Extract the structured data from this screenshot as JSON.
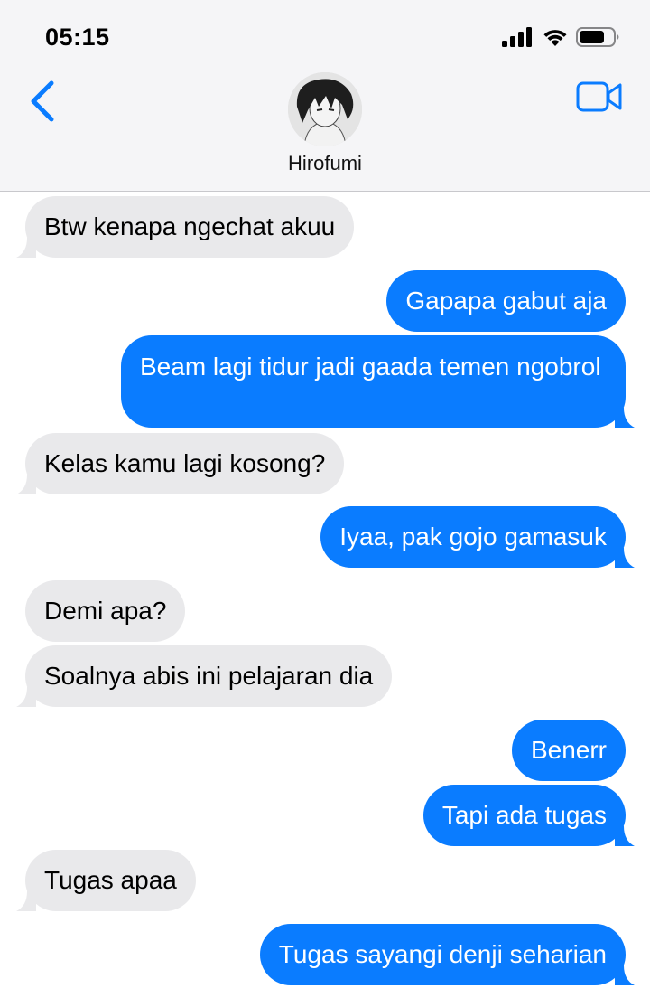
{
  "status_bar": {
    "time": "05:15"
  },
  "header": {
    "contact_name": "Hirofumi"
  },
  "icons": {
    "back": "chevron-left-icon",
    "video": "video-camera-icon",
    "signal": "signal-bars-icon",
    "wifi": "wifi-icon",
    "battery": "battery-icon"
  },
  "colors": {
    "accent": "#0a7cff",
    "incoming_bubble": "#e9e9eb",
    "header_bg": "#f5f5f7"
  },
  "messages": [
    {
      "from": "them",
      "text": "Btw kenapa ngechat akuu"
    },
    {
      "from": "me",
      "text": "Gapapa gabut aja"
    },
    {
      "from": "me",
      "text": "Beam lagi tidur jadi gaada temen ngobrol"
    },
    {
      "from": "them",
      "text": "Kelas kamu lagi kosong?"
    },
    {
      "from": "me",
      "text": "Iyaa, pak gojo gamasuk"
    },
    {
      "from": "them",
      "text": "Demi apa?"
    },
    {
      "from": "them",
      "text": "Soalnya abis ini pelajaran dia"
    },
    {
      "from": "me",
      "text": "Benerr"
    },
    {
      "from": "me",
      "text": "Tapi ada tugas"
    },
    {
      "from": "them",
      "text": "Tugas apaa"
    },
    {
      "from": "me",
      "text": "Tugas sayangi denji seharian"
    }
  ]
}
